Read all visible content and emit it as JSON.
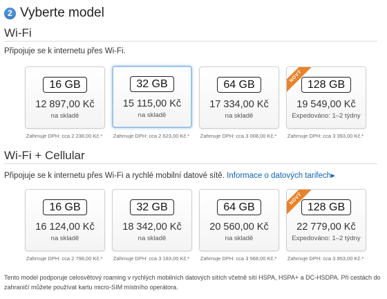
{
  "header": {
    "step_number": "2",
    "title": "Vyberte model"
  },
  "wifi": {
    "title": "Wi-Fi",
    "description": "Připojuje se k internetu přes Wi-Fi.",
    "models": [
      {
        "capacity": "16 GB",
        "price": "12 897,00 Kč",
        "availability": "na skladě",
        "vat": "Zahrnuje DPH: cca 2 238,00 Kč.*",
        "badge": "",
        "selected": false
      },
      {
        "capacity": "32 GB",
        "price": "15 115,00 Kč",
        "availability": "na skladě",
        "vat": "Zahrnuje DPH: cca 2 623,00 Kč.*",
        "badge": "",
        "selected": true
      },
      {
        "capacity": "64 GB",
        "price": "17 334,00 Kč",
        "availability": "na skladě",
        "vat": "Zahrnuje DPH: cca 3 008,00 Kč.*",
        "badge": "",
        "selected": false
      },
      {
        "capacity": "128 GB",
        "price": "19 549,00 Kč",
        "availability": "Expedováno:  1–2 týdny",
        "vat": "Zahrnuje DPH: cca 3 393,00 Kč.*",
        "badge": "NOVÝ",
        "selected": false
      }
    ]
  },
  "cellular": {
    "title": "Wi-Fi + Cellular",
    "description": "Připojuje se k internetu přes Wi-Fi a rychlé mobilní datové sítě.",
    "link_label": "Informace o datových tarifech",
    "link_arrow": "▸",
    "models": [
      {
        "capacity": "16 GB",
        "price": "16 124,00 Kč",
        "availability": "na skladě",
        "vat": "Zahrnuje DPH: cca 2 798,00 Kč.*",
        "badge": "",
        "selected": false
      },
      {
        "capacity": "32 GB",
        "price": "18 342,00 Kč",
        "availability": "na skladě",
        "vat": "Zahrnuje DPH: cca 3 183,00 Kč.*",
        "badge": "",
        "selected": false
      },
      {
        "capacity": "64 GB",
        "price": "20 560,00 Kč",
        "availability": "na skladě",
        "vat": "Zahrnuje DPH: cca 3 568,00 Kč.*",
        "badge": "",
        "selected": false
      },
      {
        "capacity": "128 GB",
        "price": "22 779,00 Kč",
        "availability": "Expedováno:  1–2 týdny",
        "vat": "Zahrnuje DPH: cca 3 953,00 Kč.*",
        "badge": "NOVÝ",
        "selected": false
      }
    ]
  },
  "footnote": "Tento model podporuje celosvětový roaming v rychlých mobilních datových sítích včetně sítí HSPA, HSPA+ a DC-HSDPA. Při cestách do zahraničí můžete používat kartu micro-SIM místního operátora.",
  "colors": {
    "accent_badge": "#4a90d9",
    "link": "#0f62b4",
    "ribbon": "#e8832a",
    "selected_border": "#9dc4e7"
  }
}
